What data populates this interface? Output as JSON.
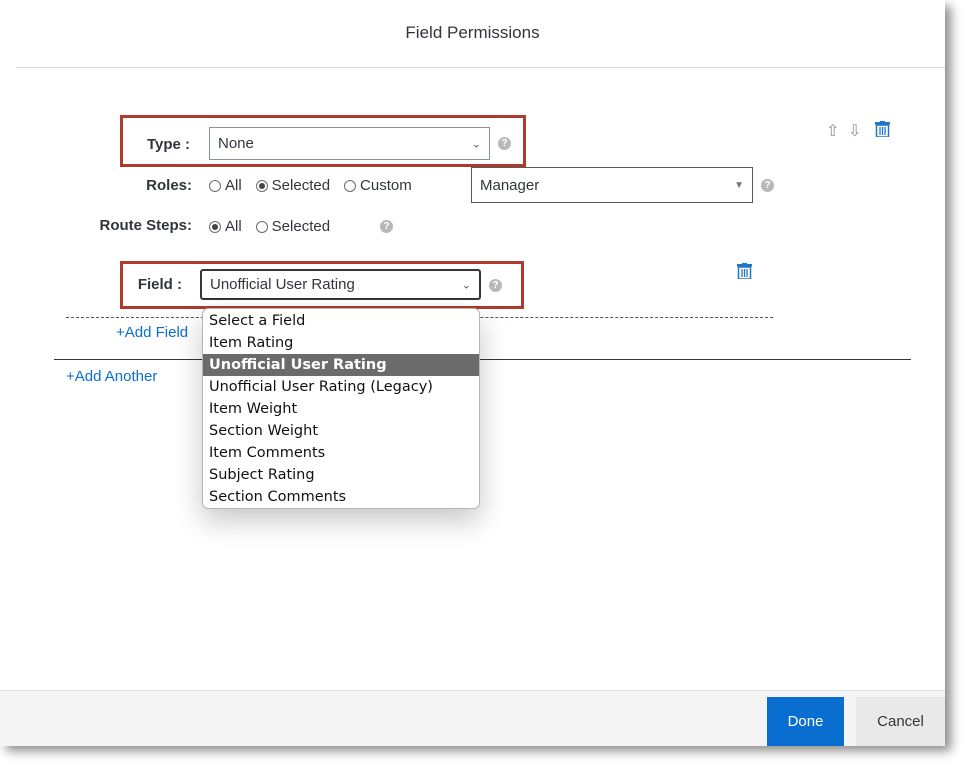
{
  "dialog": {
    "title": "Field Permissions"
  },
  "type_row": {
    "label": "Type :",
    "value": "None",
    "help": "?"
  },
  "roles_row": {
    "label": "Roles:",
    "options": [
      "All",
      "Selected",
      "Custom"
    ],
    "selected": "Selected",
    "role_value": "Manager",
    "help": "?"
  },
  "route_steps_row": {
    "label": "Route Steps:",
    "options": [
      "All",
      "Selected"
    ],
    "selected": "All",
    "help": "?"
  },
  "field_row": {
    "label": "Field :",
    "value": "Unofficial User Rating",
    "help": "?"
  },
  "field_dropdown": {
    "options": [
      "Select a Field",
      "Item Rating",
      "Unofficial User Rating",
      "Unofficial User Rating (Legacy)",
      "Item Weight",
      "Section Weight",
      "Item Comments",
      "Subject Rating",
      "Section Comments"
    ],
    "highlighted": "Unofficial User Rating"
  },
  "links": {
    "add_field": "+Add Field",
    "add_another": "+Add Another"
  },
  "icons": {
    "move_up": "arrow-up-icon",
    "move_down": "arrow-down-icon",
    "delete": "trash-icon"
  },
  "footer": {
    "done_label": "Done",
    "cancel_label": "Cancel"
  },
  "colors": {
    "accent": "#0a6ed1",
    "highlight_box": "#b03a2e",
    "selected_option_bg": "#6b6b6b"
  }
}
